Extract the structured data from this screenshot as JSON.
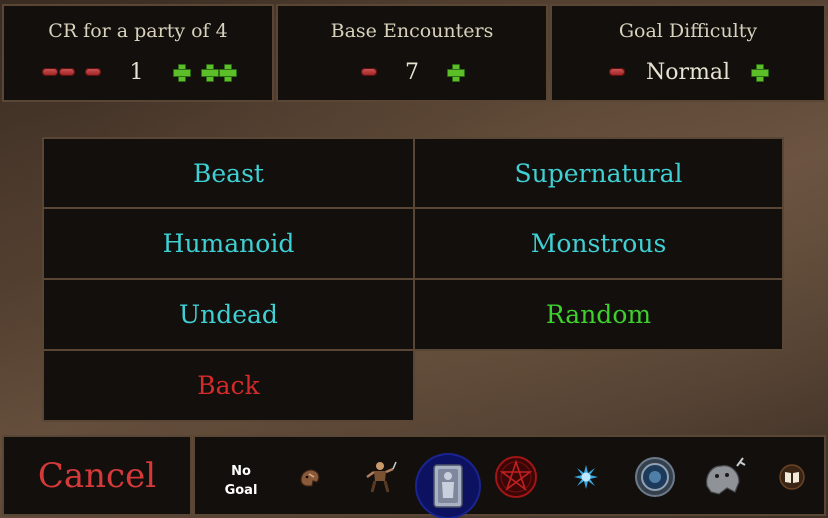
{
  "settings": {
    "cr": {
      "title": "CR for a party of 4",
      "value": "1"
    },
    "encounters": {
      "title": "Base Encounters",
      "value": "7"
    },
    "difficulty": {
      "title": "Goal Difficulty",
      "value": "Normal"
    }
  },
  "categories": {
    "beast": "Beast",
    "supernatural": "Supernatural",
    "humanoid": "Humanoid",
    "monstrous": "Monstrous",
    "undead": "Undead",
    "random": "Random",
    "back": "Back"
  },
  "bottom": {
    "cancel": "Cancel",
    "no_goal_line1": "No",
    "no_goal_line2": "Goal"
  },
  "colors": {
    "category_text": "#3fd0d4",
    "random_text": "#3dd12e",
    "back_text": "#d42a2a",
    "cancel_text": "#d43a3a"
  },
  "goal_icons": [
    "beast-head-icon",
    "humanoid-warrior-icon",
    "undead-sarcophagus-icon",
    "pentagram-icon",
    "spiky-orb-icon",
    "portal-ring-icon",
    "monster-icon",
    "spellbook-icon"
  ]
}
